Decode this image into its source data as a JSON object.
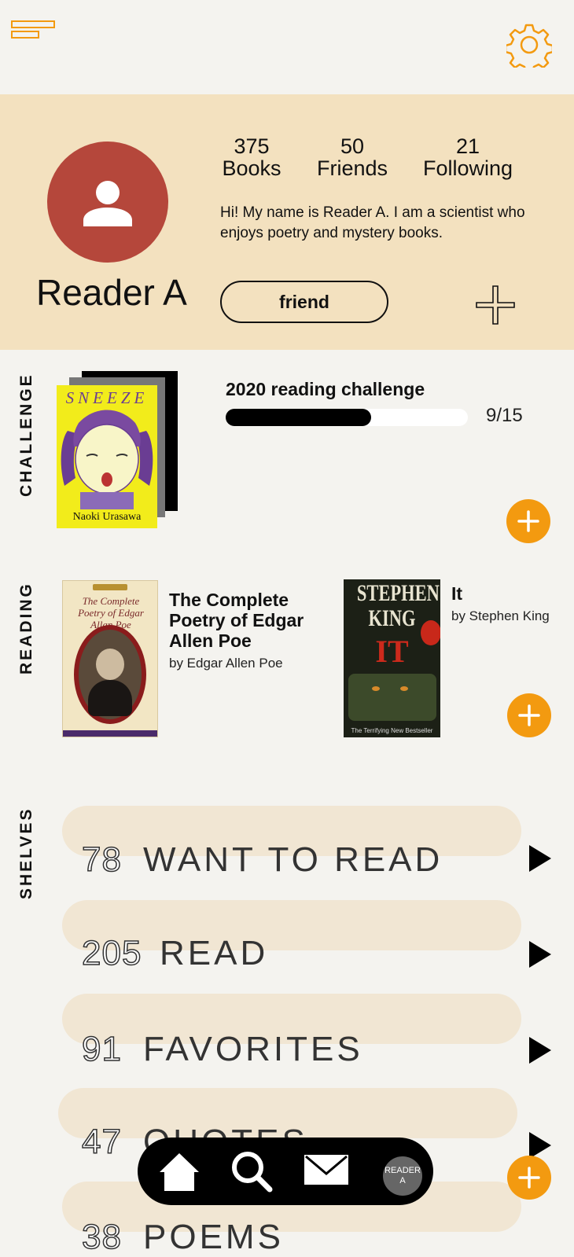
{
  "header": {
    "menu_icon": "menu-icon",
    "settings_icon": "gear-icon",
    "accent": "#f39a10"
  },
  "profile": {
    "name": "Reader A",
    "stats": [
      {
        "value": "375",
        "label": "Books"
      },
      {
        "value": "50",
        "label": "Friends"
      },
      {
        "value": "21",
        "label": "Following"
      }
    ],
    "bio": "Hi! My name is Reader A. I am a scientist who enjoys poetry and mystery books.",
    "friend_button": "friend",
    "add_icon": "plus-icon",
    "avatar_color": "#b5473b",
    "banner_color": "#f3e1bf"
  },
  "challenge": {
    "section_label": "CHALLENGE",
    "title": "2020 reading challenge",
    "progress_text": "9/15",
    "progress_value": 0.6,
    "cover": {
      "title": "SNEEZE",
      "author": "Naoki Urasawa"
    }
  },
  "reading": {
    "section_label": "READING",
    "books": [
      {
        "title": "The Complete Poetry of Edgar Allen Poe",
        "author": "by Edgar Allen Poe",
        "cover_title": "The Complete Poetry of Edgar Allan Poe"
      },
      {
        "title": "It",
        "author": "by Stephen King",
        "cover_author": "STEPHEN KING",
        "cover_title": "IT",
        "cover_tagline": "The Terrifying New Bestseller"
      }
    ]
  },
  "shelves": {
    "section_label": "SHELVES",
    "items": [
      {
        "count": "78",
        "name": "WANT TO READ"
      },
      {
        "count": "205",
        "name": "READ"
      },
      {
        "count": "91",
        "name": "FAVORITES"
      },
      {
        "count": "47",
        "name": "QUOTES"
      },
      {
        "count": "38",
        "name": "POEMS"
      }
    ]
  },
  "bottom_nav": {
    "items": [
      "home-icon",
      "search-icon",
      "mail-icon"
    ],
    "avatar_line1": "READER",
    "avatar_line2": "A"
  }
}
